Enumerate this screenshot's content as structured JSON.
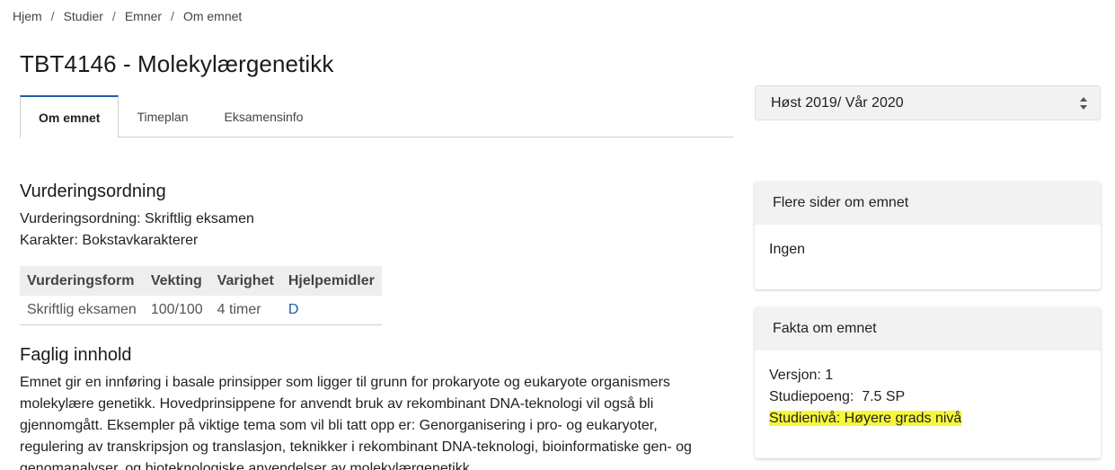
{
  "breadcrumb": [
    "Hjem",
    "Studier",
    "Emner",
    "Om emnet"
  ],
  "title": "TBT4146 - Molekylærgenetikk",
  "tabs": [
    {
      "label": "Om emnet",
      "active": true
    },
    {
      "label": "Timeplan",
      "active": false
    },
    {
      "label": "Eksamensinfo",
      "active": false
    }
  ],
  "semester": {
    "selected": "Høst 2019/ Vår 2020"
  },
  "assessment": {
    "heading": "Vurderingsordning",
    "line1": "Vurderingsordning: Skriftlig eksamen",
    "line2": "Karakter: Bokstavkarakterer",
    "table": {
      "headers": [
        "Vurderingsform",
        "Vekting",
        "Varighet",
        "Hjelpemidler"
      ],
      "rows": [
        [
          "Skriftlig eksamen",
          "100/100",
          "4 timer",
          "D"
        ]
      ]
    }
  },
  "content": {
    "heading": "Faglig innhold",
    "lines": [
      "Emnet gir en innføring i basale prinsipper som ligger til grunn for prokaryote og eukaryote organismers",
      "molekylære genetikk. Hovedprinsippene for anvendt bruk av rekombinant DNA-teknologi vil også bli",
      "gjennomgått. Eksempler på viktige tema som vil bli tatt opp er: Genorganisering i pro- og eukaryoter,",
      "regulering av transkripsjon og translasjon, teknikker i rekombinant DNA-teknologi, bioinformatiske gen- og",
      "genomanalyser, og bioteknologiske anvendelser av molekylærgenetikk."
    ]
  },
  "more_pages": {
    "header": "Flere sider om emnet",
    "body": "Ingen"
  },
  "facts": {
    "header": "Fakta om emnet",
    "version": "Versjon: 1",
    "credits": "Studiepoeng:  7.5 SP",
    "level": "Studienivå: Høyere grads nivå"
  },
  "colors": {
    "accent": "#1d5ea8",
    "highlight": "#f7f73a"
  }
}
